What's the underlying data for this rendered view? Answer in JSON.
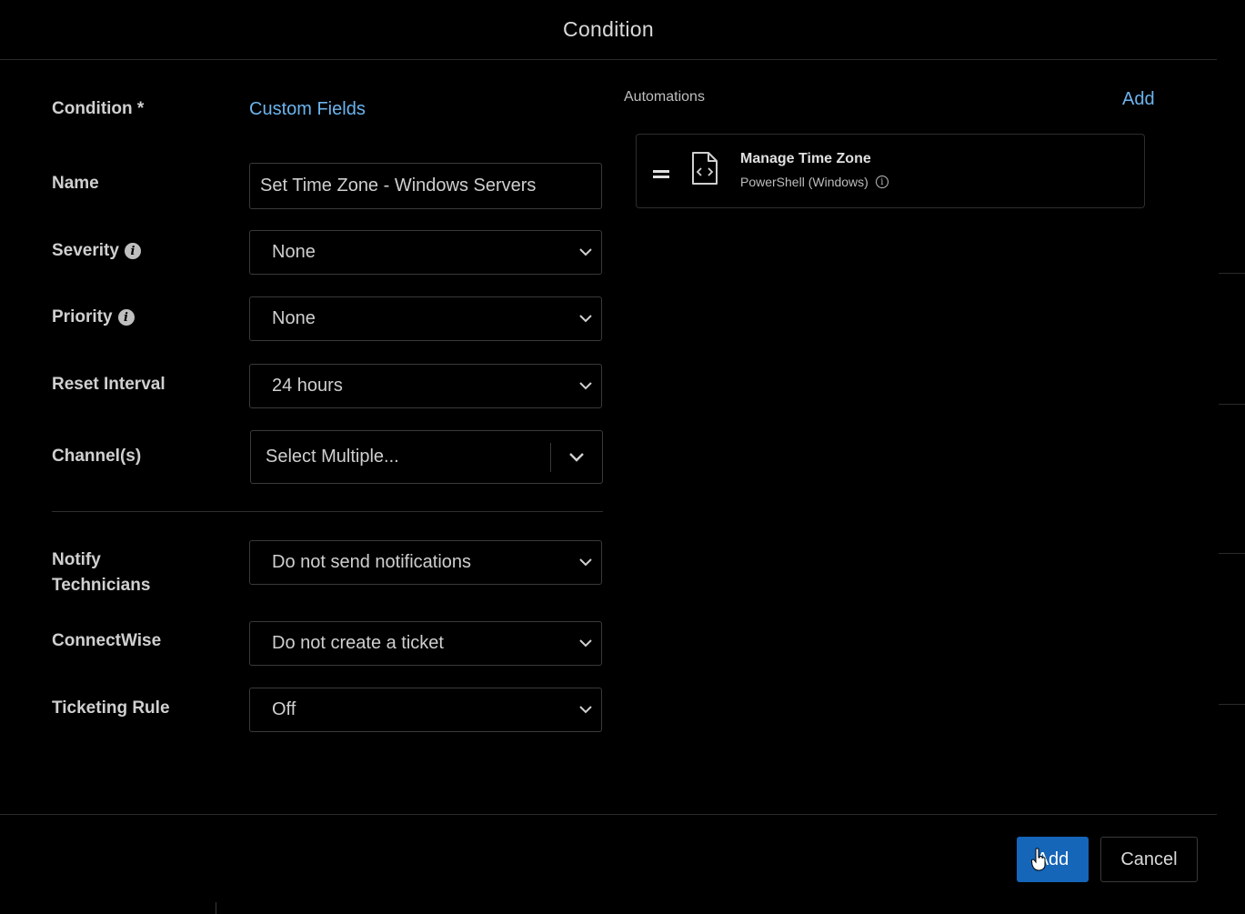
{
  "dialog": {
    "title": "Condition"
  },
  "form": {
    "condition": {
      "label": "Condition *",
      "link": "Custom Fields"
    },
    "name": {
      "label": "Name",
      "value": "Set Time Zone - Windows Servers"
    },
    "severity": {
      "label": "Severity",
      "value": "None"
    },
    "priority": {
      "label": "Priority",
      "value": "None"
    },
    "reset_interval": {
      "label": "Reset Interval",
      "value": "24 hours"
    },
    "channels": {
      "label": "Channel(s)",
      "placeholder": "Select Multiple..."
    },
    "notify": {
      "label_line1": "Notify",
      "label_line2": "Technicians",
      "value": "Do not send notifications"
    },
    "connectwise": {
      "label": "ConnectWise",
      "value": "Do not create a ticket"
    },
    "ticketing_rule": {
      "label": "Ticketing Rule",
      "value": "Off"
    }
  },
  "automations": {
    "title": "Automations",
    "add_label": "Add",
    "items": [
      {
        "name": "Manage Time Zone",
        "type": "PowerShell (Windows)"
      }
    ]
  },
  "footer": {
    "add_label": "Add",
    "cancel_label": "Cancel"
  },
  "colors": {
    "link": "#6cb4ee",
    "primary_button": "#1565b8",
    "background": "#000000"
  }
}
